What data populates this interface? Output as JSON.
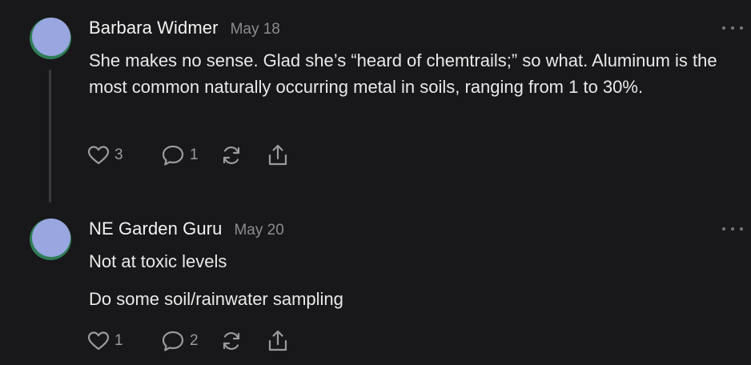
{
  "comments": [
    {
      "author": "Barbara Widmer",
      "date": "May 18",
      "paragraphs": [
        "She makes no sense. Glad she’s “heard of chemtrails;” so what. Aluminum is the most common naturally occurring metal in soils, ranging from 1 to 30%."
      ],
      "likes": "3",
      "replies": "1"
    },
    {
      "author": "NE Garden Guru",
      "date": "May 20",
      "paragraphs": [
        "Not at toxic levels",
        "Do some soil/rainwater sampling"
      ],
      "likes": "1",
      "replies": "2"
    }
  ],
  "icons": {
    "like": "heart-icon",
    "reply": "comment-icon",
    "restack": "restack-icon",
    "share": "share-icon",
    "more": "more-horizontal-icon"
  },
  "colors": {
    "background": "#18181a",
    "avatar_fill": "#9aa6e0",
    "avatar_ring_orange": "#e88b3f",
    "avatar_ring_green": "#2f7d57"
  }
}
